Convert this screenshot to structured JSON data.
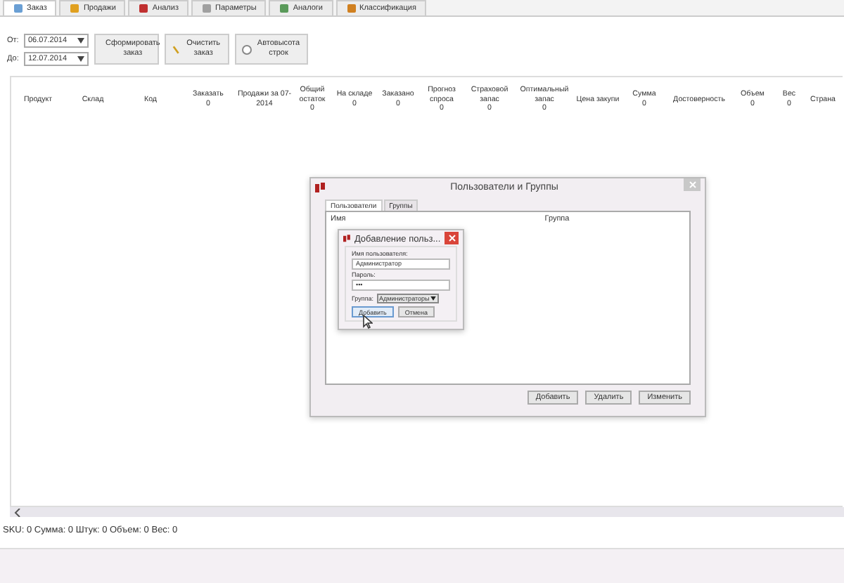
{
  "tabs": [
    {
      "label": "Заказ",
      "selected": true
    },
    {
      "label": "Продажи",
      "selected": false
    },
    {
      "label": "Анализ",
      "selected": false
    },
    {
      "label": "Параметры",
      "selected": false
    },
    {
      "label": "Аналоги",
      "selected": false
    },
    {
      "label": "Классификация",
      "selected": false
    }
  ],
  "filters": [
    {
      "label": "От:",
      "value": "06.07.2014"
    },
    {
      "label": "До:",
      "value": "12.07.2014"
    }
  ],
  "actions": [
    {
      "label": "Сформировать заказ"
    },
    {
      "label": "Очистить заказ"
    }
  ],
  "auto_height": {
    "label": "Автовысота строк",
    "checked": false
  },
  "columns": [
    {
      "label": "Продукт"
    },
    {
      "label": "Склад"
    },
    {
      "label": "Код"
    },
    {
      "label": "Заказать",
      "value": "0"
    },
    {
      "label": "Продажи за 07-2014"
    },
    {
      "label": "Общий остаток",
      "value": "0"
    },
    {
      "label": "На складе",
      "value": "0"
    },
    {
      "label": "Заказано",
      "value": "0"
    },
    {
      "label": "Прогноз спроса",
      "value": "0"
    },
    {
      "label": "Страховой запас",
      "value": "0"
    },
    {
      "label": "Оптимальный запас",
      "value": "0"
    },
    {
      "label": "Цена закупи"
    },
    {
      "label": "Сумма",
      "value": "0"
    },
    {
      "label": "Достоверность"
    },
    {
      "label": "Объем",
      "value": "0"
    },
    {
      "label": "Вес",
      "value": "0"
    },
    {
      "label": "Страна"
    }
  ],
  "status_bar": "SKU: 0 Сумма: 0 Штук: 0 Объем: 0 Вес: 0",
  "users_dialog": {
    "title": "Пользователи и Группы",
    "tabs": [
      {
        "label": "Пользователи",
        "selected": true
      },
      {
        "label": "Группы",
        "selected": false
      }
    ],
    "columns": [
      "Имя",
      "Группа"
    ],
    "buttons": [
      "Добавить",
      "Удалить",
      "Изменить"
    ]
  },
  "add_user_dialog": {
    "title": "Добавление польз...",
    "username_label": "Имя пользователя:",
    "username": "Администратор",
    "password_label": "Пароль:",
    "password": "•••",
    "group_label": "Группа:",
    "group": "Администраторы",
    "buttons": [
      {
        "label": "Добавить",
        "focused": true
      },
      {
        "label": "Отмена",
        "focused": false
      }
    ]
  }
}
